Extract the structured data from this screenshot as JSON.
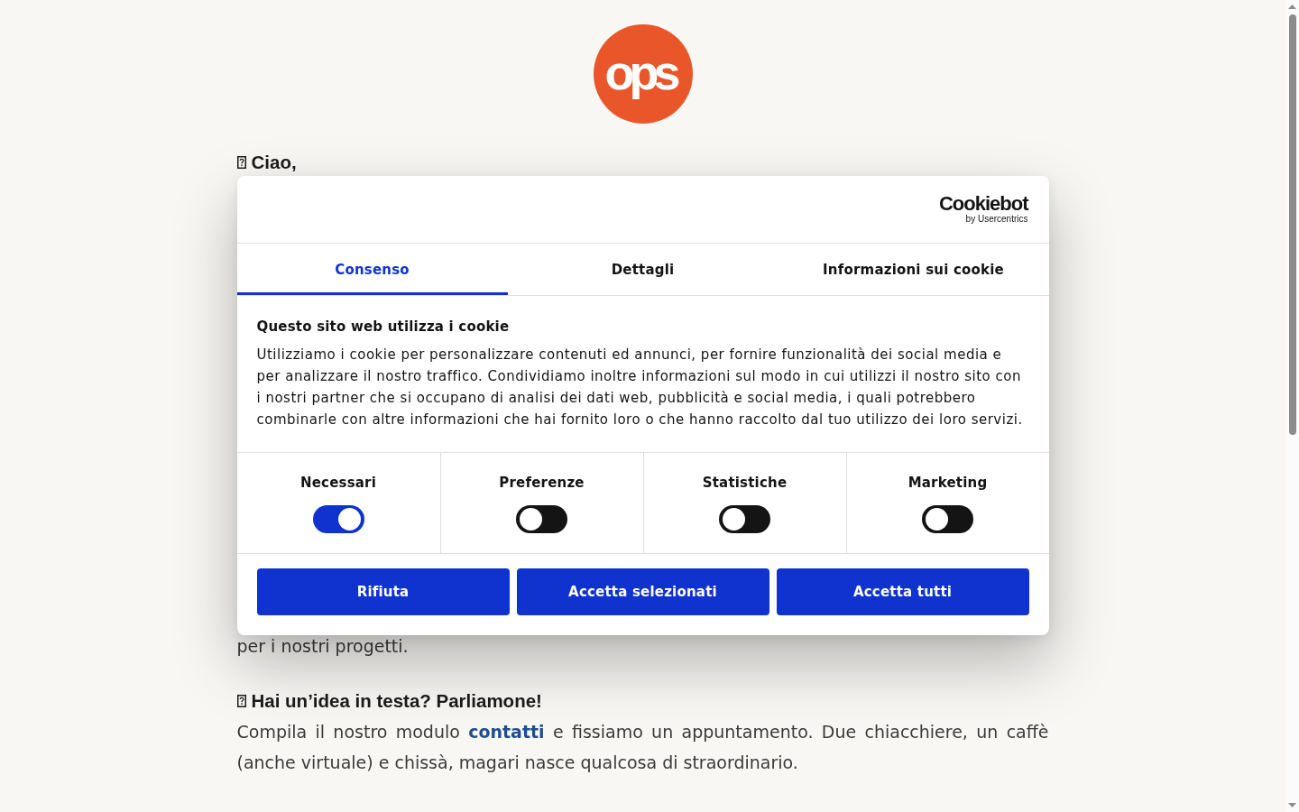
{
  "site_logo": {
    "text": "ops"
  },
  "greeting": {
    "heading": "Ciao,"
  },
  "cookie_dialog": {
    "brand": {
      "name": "Cookiebot",
      "tagline": "by Usercentrics"
    },
    "tabs": [
      {
        "label": "Consenso",
        "selected": true
      },
      {
        "label": "Dettagli",
        "selected": false
      },
      {
        "label": "Informazioni sui cookie",
        "selected": false
      }
    ],
    "title": "Questo sito web utilizza i cookie",
    "text": "Utilizziamo i cookie per personalizzare contenuti ed annunci, per fornire funzionalità dei social media e per analizzare il nostro traffico. Condividiamo inoltre informazioni sul modo in cui utilizzi il nostro sito con i nostri partner che si occupano di analisi dei dati web, pubblicità e social media, i quali potrebbero combinarle con altre informazioni che hai fornito loro o che hanno raccolto dal tuo utilizzo dei loro servizi.",
    "toggles": [
      {
        "label": "Necessari",
        "checked": true
      },
      {
        "label": "Preferenze",
        "checked": false
      },
      {
        "label": "Statistiche",
        "checked": false
      },
      {
        "label": "Marketing",
        "checked": false
      }
    ],
    "buttons": [
      "Rifiuta",
      "Accetta selezionati",
      "Accetta tutti"
    ]
  },
  "content": {
    "tail": "per i nostri progetti.",
    "contact": {
      "heading": "Hai un’idea in testa? Parliamone!",
      "text_before": "Compila il nostro modulo",
      "link": "contatti",
      "text_after": "e fissiamo un appuntamento. Due chiacchiere, un caffè (anche virtuale) e chissà, magari nasce qualcosa di straordinario."
    }
  }
}
